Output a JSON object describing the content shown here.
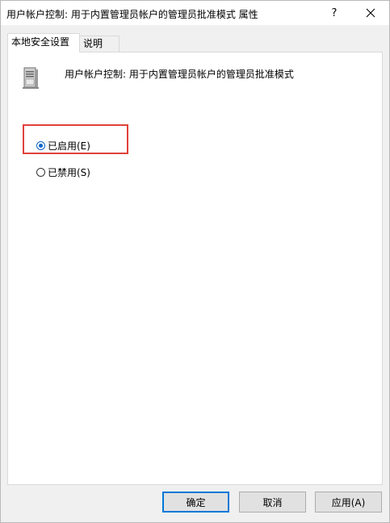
{
  "window": {
    "title": "用户帐户控制: 用于内置管理员帐户的管理员批准模式 属性"
  },
  "titlebar": {
    "help_label": "?",
    "close_icon": "close-icon"
  },
  "tabs": [
    {
      "label": "本地安全设置",
      "active": true
    },
    {
      "label": "说明",
      "active": false
    }
  ],
  "policy": {
    "icon": "server-policy-icon",
    "name": "用户帐户控制: 用于内置管理员帐户的管理员批准模式"
  },
  "options": [
    {
      "label": "已启用(E)",
      "checked": true
    },
    {
      "label": "已禁用(S)",
      "checked": false
    }
  ],
  "buttons": {
    "ok": "确定",
    "cancel": "取消",
    "apply": "应用(A)"
  },
  "colors": {
    "highlight_border": "#e0413b",
    "accent": "#0078d7"
  }
}
